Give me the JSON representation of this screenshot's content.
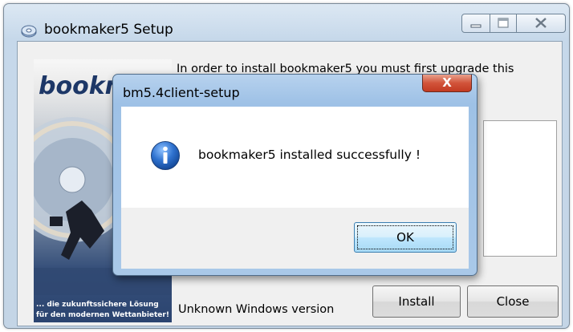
{
  "main_window": {
    "title": "bookmaker5 Setup",
    "intro_text": "In order to install bookmaker5 you must first upgrade this",
    "status_text": "Unknown Windows version",
    "install_label": "Install",
    "close_label": "Close",
    "banner": {
      "logo_text": "bookm",
      "slogan_line1": "... die zukunftssichere Lösung",
      "slogan_line2": "für den modernen Wettanbieter!"
    }
  },
  "dialog": {
    "title": "bm5.4client-setup",
    "message": "bookmaker5 installed successfully !",
    "ok_label": "OK",
    "close_glyph": "X",
    "icon": "info-icon"
  },
  "colors": {
    "dialog_frame": "#9ec1e6",
    "close_button_red": "#c23a22",
    "info_icon_blue": "#1f5fb8"
  }
}
